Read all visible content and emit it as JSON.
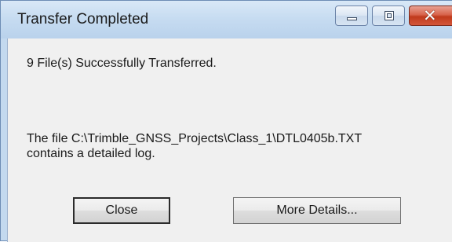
{
  "window": {
    "title": "Transfer Completed"
  },
  "title_buttons": {
    "minimize": "minimize-icon",
    "maximize": "maximize-icon",
    "close": "close-icon"
  },
  "message": {
    "summary": "9 File(s) Successfully Transferred.",
    "log_line1": "The file C:\\Trimble_GNSS_Projects\\Class_1\\DTL0405b.TXT",
    "log_line2": "contains a detailed log."
  },
  "buttons": {
    "close_label": "Close",
    "more_details_label": "More Details..."
  },
  "colors": {
    "close_button": "#c8432a",
    "titlebar": "#c7dcf1",
    "client": "#f0f0f0"
  }
}
